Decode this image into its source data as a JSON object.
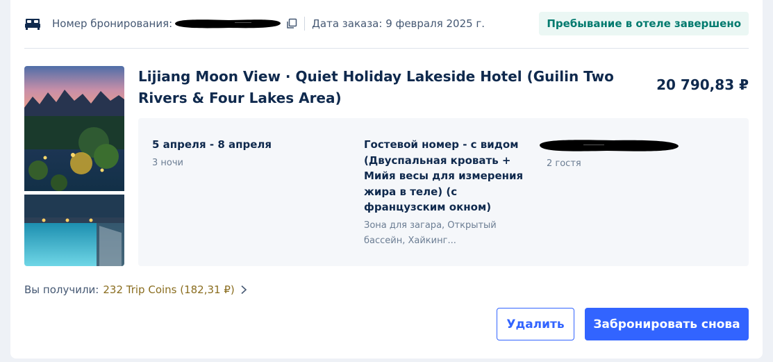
{
  "header": {
    "booking_label": "Номер бронирования:",
    "order_date": "Дата заказа: 9 февраля 2025 г.",
    "status": "Пребывание в отеле завершено"
  },
  "hotel": {
    "name": "Lijiang Moon View · Quiet Holiday Lakeside Hotel (Guilin Two Rivers & Four Lakes Area)",
    "price": "20 790,83 ₽"
  },
  "stay": {
    "dates": "5 апреля - 8 апреля",
    "nights": "3 ночи"
  },
  "room": {
    "name": "Гостевой номер - с видом (Двуспальная кровать + Мийя весы для измерения жира в теле) (с французским окном)",
    "amenities": "Зона для загара, Открытый бассейн, Хайкинг..."
  },
  "guests": {
    "count": "2 гостя"
  },
  "rewards": {
    "label": "Вы получили:",
    "coins": "232 Trip Coins (182,31 ₽)"
  },
  "actions": {
    "delete_label": "Удалить",
    "rebook_label": "Забронировать снова"
  },
  "colors": {
    "accent": "#3264ff",
    "status_text": "#007a6e",
    "status_bg": "#ebf7f4",
    "coins_gold": "#8a6d1f"
  },
  "icons": [
    "bed-icon",
    "copy-icon",
    "chevron-right-icon"
  ]
}
